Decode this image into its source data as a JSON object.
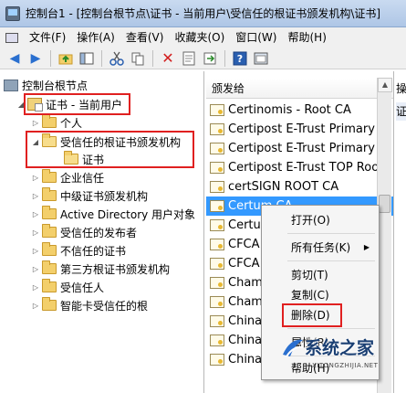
{
  "window": {
    "title": "控制台1 - [控制台根节点\\证书 - 当前用户\\受信任的根证书颁发机构\\证书]"
  },
  "menu": {
    "items": [
      "文件(F)",
      "操作(A)",
      "查看(V)",
      "收藏夹(O)",
      "窗口(W)",
      "帮助(H)"
    ]
  },
  "toolbar": {
    "icons": [
      "back-icon",
      "forward-icon",
      "up-folder-icon",
      "show-hide-tree-icon",
      "cut-icon",
      "copy-icon",
      "delete-icon",
      "properties-icon",
      "export-icon",
      "help-icon",
      "console-icon"
    ]
  },
  "tree": {
    "root": "控制台根节点",
    "cert_current_user": "证书 - 当前用户",
    "items": {
      "personal": "个人",
      "trusted_root": "受信任的根证书颁发机构",
      "certificates": "证书",
      "enterprise_trust": "企业信任",
      "intermediate_ca": "中级证书颁发机构",
      "ad_user_object": "Active Directory 用户对象",
      "trusted_publishers": "受信任的发布者",
      "untrusted_certs": "不信任的证书",
      "third_party_root": "第三方根证书颁发机构",
      "trusted_people": "受信任人",
      "smart_card_root": "智能卡受信任的根"
    }
  },
  "list": {
    "column_header": "颁发给",
    "rows": [
      "Certinomis - Root CA",
      "Certipost E-Trust Primary N",
      "Certipost E-Trust Primary Q",
      "Certipost E-Trust TOP Root",
      "certSIGN ROOT CA",
      "Certum CA",
      "Certum",
      "CFCA",
      "CFCA",
      "Cham",
      "Cham",
      "China",
      "China",
      "China"
    ],
    "selected_index": 5
  },
  "context_menu": {
    "open": "打开(O)",
    "all_tasks": "所有任务(K)",
    "cut": "剪切(T)",
    "copy": "复制(C)",
    "delete": "删除(D)",
    "properties": "属性(R)",
    "help": "帮助(H)"
  },
  "right_pane": {
    "header": "操",
    "sub": "证"
  },
  "watermark": {
    "brand": "系统之家",
    "url": "XITONGZHIJIA.NET"
  },
  "colors": {
    "selection": "#3399ff",
    "highlight_box": "#e02020",
    "watermark": "#1a3f73"
  }
}
